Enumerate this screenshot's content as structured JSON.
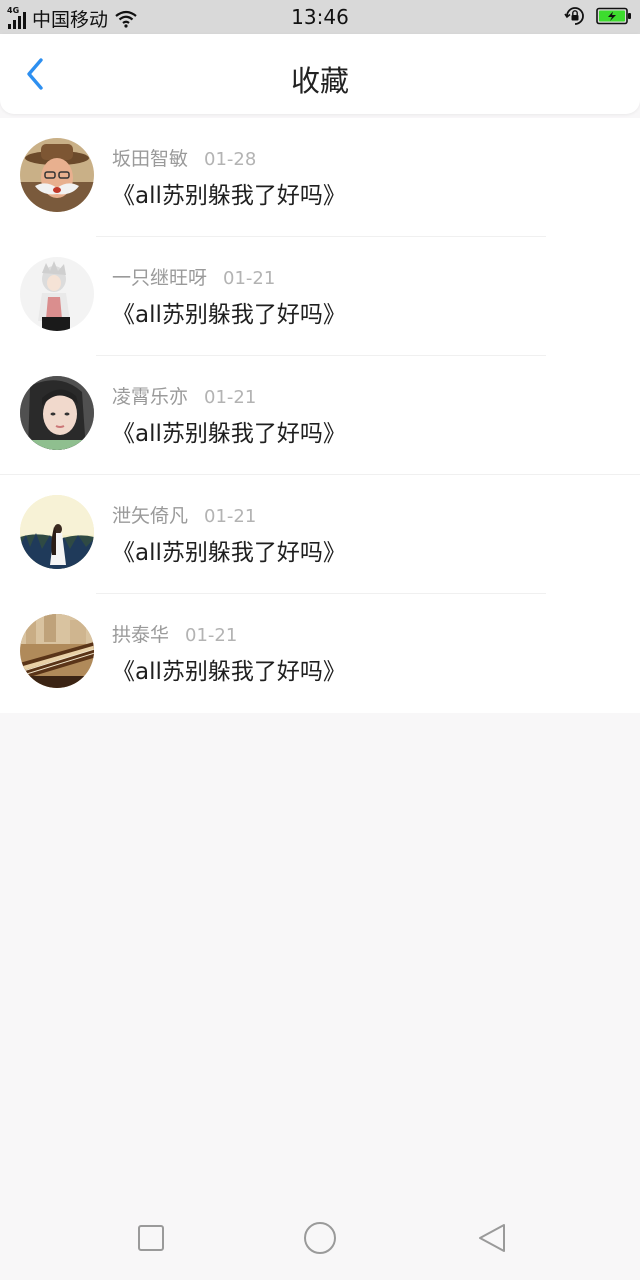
{
  "status_bar": {
    "network": "4G",
    "carrier": "中国移动",
    "time": "13:46",
    "battery_color": "#3ddc2e"
  },
  "header": {
    "title": "收藏",
    "back_icon": "chevron-left-icon",
    "accent_color": "#2d8ff0"
  },
  "items": [
    {
      "author": "坂田智敏",
      "date": "01-28",
      "title": "《all苏别躲我了好吗》",
      "avatar": "man-with-hat"
    },
    {
      "author": "一只继旺呀",
      "date": "01-21",
      "title": "《all苏别躲我了好吗》",
      "avatar": "anime-figure"
    },
    {
      "author": "凌霄乐亦",
      "date": "01-21",
      "title": "《all苏别躲我了好吗》",
      "avatar": "girl-portrait"
    },
    {
      "author": "泄矢倚凡",
      "date": "01-21",
      "title": "《all苏别躲我了好吗》",
      "avatar": "girl-in-field"
    },
    {
      "author": "拱泰华",
      "date": "01-21",
      "title": "《all苏别躲我了好吗》",
      "avatar": "guzheng-instrument"
    }
  ],
  "nav_bar": {
    "recent_icon": "square-icon",
    "home_icon": "circle-icon",
    "back_icon": "triangle-back-icon"
  }
}
